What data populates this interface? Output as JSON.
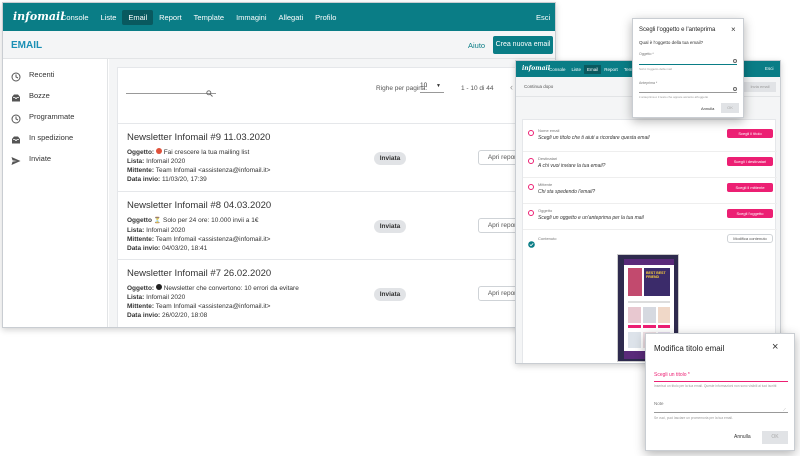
{
  "main": {
    "logo": "infomail",
    "nav": [
      "Console",
      "Liste",
      "Email",
      "Report",
      "Template",
      "Immagini",
      "Allegati",
      "Profilo"
    ],
    "nav_active": 2,
    "exit": "Esci",
    "page_title": "EMAIL",
    "help": "Aiuto",
    "create_button": "Crea nuova email",
    "sidebar": [
      {
        "label": "Recenti",
        "icon": "clock-icon"
      },
      {
        "label": "Bozze",
        "icon": "inbox-icon"
      },
      {
        "label": "Programmate",
        "icon": "clock-icon"
      },
      {
        "label": "In spedizione",
        "icon": "inbox-icon"
      },
      {
        "label": "Inviate",
        "icon": "send-icon"
      }
    ],
    "rows_per_page_label": "Righe per pagina:",
    "rows_per_page_value": "10",
    "pagination": "1 - 10 di 44",
    "emails": [
      {
        "title": "Newsletter Infomail #9 11.03.2020",
        "subject_label": "Oggetto:",
        "subject": "Fai crescere la tua mailing list",
        "list_label": "Lista:",
        "list": "Infomail 2020",
        "sender_label": "Mittente:",
        "sender": "Team Infomail <assistenza@infomail.it>",
        "date_label": "Data invio:",
        "date": "11/03/20, 17:39",
        "status": "Inviata",
        "report": "Apri report"
      },
      {
        "title": "Newsletter Infomail #8 04.03.2020",
        "subject_label": "Oggetto",
        "subject": "Solo per 24 ore: 10.000 invii a 1€",
        "list_label": "Lista:",
        "list": "Infomail 2020",
        "sender_label": "Mittente:",
        "sender": "Team Infomail <assistenza@infomail.it>",
        "date_label": "Data invio:",
        "date": "04/03/20, 18:41",
        "status": "Inviata",
        "report": "Apri report"
      },
      {
        "title": "Newsletter Infomail #7 26.02.2020",
        "subject_label": "Oggetto:",
        "subject": "Newsletter che convertono: 10 errori da evitare",
        "list_label": "Lista:",
        "list": "Infomail 2020",
        "sender_label": "Mittente:",
        "sender": "Team Infomail <assistenza@infomail.it>",
        "date_label": "Data invio:",
        "date": "26/02/20, 18:08",
        "status": "Inviata",
        "report": "Apri report"
      }
    ]
  },
  "editor": {
    "logo": "infomail",
    "nav": [
      "Console",
      "Liste",
      "Email",
      "Report",
      "Templ"
    ],
    "exit": "Esci",
    "back": "Continua dopo",
    "top_right_button": "Invia email",
    "steps": [
      {
        "label": "Nome email",
        "desc": "Scegli un titolo che ti aiuti a ricordare questa email",
        "button": "Scegli il titolo",
        "done": false
      },
      {
        "label": "Destinatari",
        "desc": "A chi vuoi inviare la tua email?",
        "button": "Scegli i destinatari",
        "done": false
      },
      {
        "label": "Mittente",
        "desc": "Chi sta spedendo l'email?",
        "button": "Scegli il mittente",
        "done": false
      },
      {
        "label": "Oggetto",
        "desc": "Scegli un oggetto e un'anteprima per la tua mail",
        "button": "Scegli l'oggetto",
        "done": false
      },
      {
        "label": "Contenuto",
        "desc": "",
        "button": "Modifica contenuto",
        "done": true
      }
    ],
    "preview_text": "BEST BEST FRIEND"
  },
  "subject_modal": {
    "title": "Scegli l'oggetto e l'anteprima",
    "question": "Qual è l'oggetto della tua email?",
    "subject_label": "Oggetto *",
    "subject_hint": "Scrivi l'oggetto della mail",
    "preview_label": "Anteprima *",
    "preview_hint": "L'anteprima è il testo che appare accanto all'oggetto",
    "cancel": "Annulla",
    "ok": "OK"
  },
  "title_modal": {
    "title": "Modifica titolo email",
    "field_label": "Scegli un titolo *",
    "field_hint": "Inserisci un titolo per la tua email. Queste informazioni non sono visibili ai tuoi iscritti",
    "notes_label": "Note",
    "notes_hint": "Se vuoi, puoi lasciare un promemoria per la tua email.",
    "cancel": "Annulla",
    "ok": "OK"
  },
  "colors": {
    "teal": "#0a7d86",
    "pink": "#ec1f73",
    "title_blue": "#1a8fb5"
  }
}
